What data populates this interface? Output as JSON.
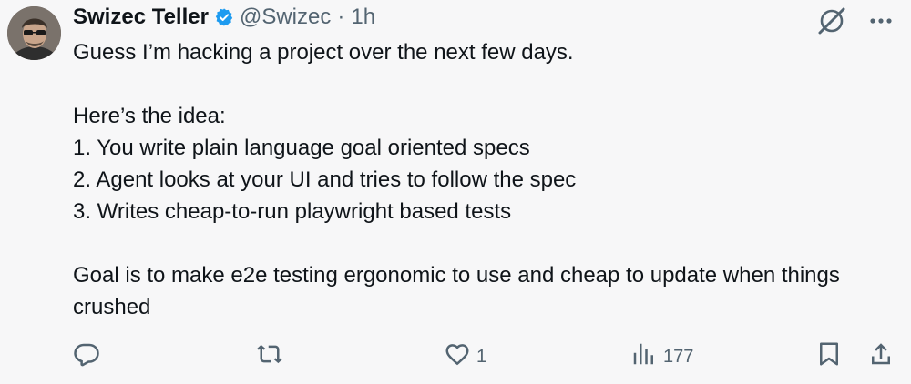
{
  "author": {
    "name": "Swizec Teller",
    "handle": "@Swizec",
    "separator": "·",
    "time": "1h",
    "verified_color": "#1d9bf0"
  },
  "tweet": {
    "text": "Guess I’m hacking a project over the next few days.\n\nHere’s the idea:\n1. You write plain language goal oriented specs\n2. Agent looks at your UI and tries to follow the spec\n3. Writes cheap-to-run playwright based tests\n\nGoal is to make e2e testing ergonomic to use and cheap to update when things crushed"
  },
  "top_actions": {
    "grok_icon": "grok-icon",
    "more_icon": "more-icon"
  },
  "actions": {
    "reply": {
      "icon": "reply-icon",
      "count": ""
    },
    "retweet": {
      "icon": "retweet-icon",
      "count": ""
    },
    "like": {
      "icon": "heart-icon",
      "count": "1"
    },
    "views": {
      "icon": "views-icon",
      "count": "177"
    },
    "bookmark": {
      "icon": "bookmark-icon"
    },
    "share": {
      "icon": "share-icon"
    }
  }
}
